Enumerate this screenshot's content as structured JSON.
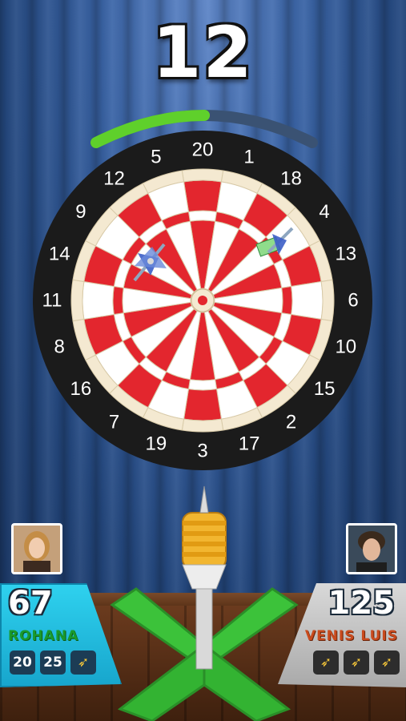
{
  "turn_score": "12",
  "timer": {
    "fill_fraction": 0.5
  },
  "board_numbers": [
    "20",
    "1",
    "18",
    "4",
    "13",
    "6",
    "10",
    "15",
    "2",
    "17",
    "3",
    "19",
    "7",
    "16",
    "8",
    "11",
    "14",
    "9",
    "12",
    "5"
  ],
  "player1": {
    "score": "67",
    "name": "ROHANA",
    "throws": [
      "20",
      "25"
    ],
    "darts_left_icon": "dart-icon",
    "avatar": "player-portrait-woman"
  },
  "player2": {
    "score": "125",
    "name": "VENIS LUIS",
    "darts_left_icons": [
      "dart-icon",
      "dart-icon",
      "dart-icon"
    ],
    "avatar": "player-portrait-man"
  },
  "colors": {
    "board_red": "#e3262e",
    "board_cream": "#f4e9d1",
    "board_white": "#ffffff",
    "timer_green": "#5fd02b",
    "dart_flight_green": "#3cc23a",
    "p1_panel": "#26c2e6",
    "p2_name": "#c94a1d"
  }
}
